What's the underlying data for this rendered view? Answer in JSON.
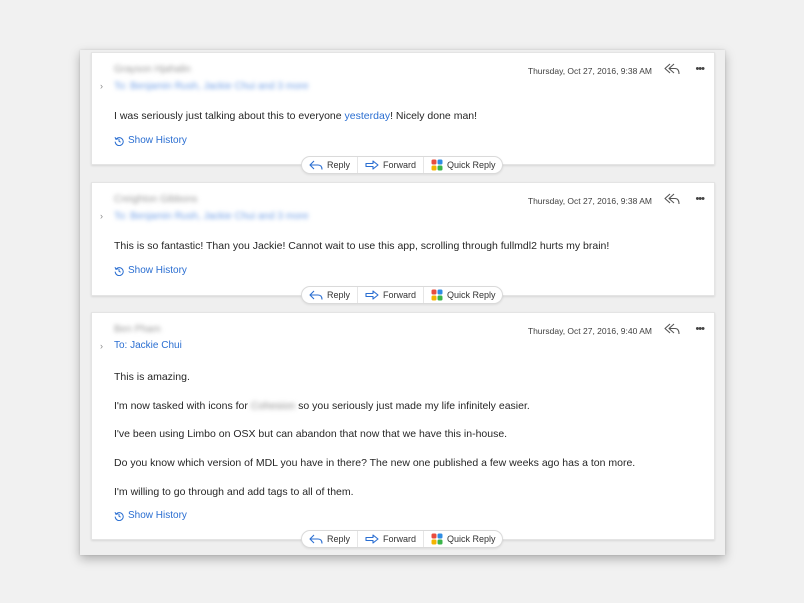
{
  "messages": [
    {
      "sender": "Grayson Hjahalin",
      "recipients": "To: Benjamin Rush, Jackie Chui and 3 more",
      "timestamp": "Thursday, Oct 27, 2016, 9:38 AM",
      "body": {
        "before": "I was seriously just talking about this to everyone ",
        "link": "yesterday",
        "after": "! Nicely done man!"
      },
      "show_history": "Show History"
    },
    {
      "sender": "Creighton Gibbons",
      "recipients": "To: Benjamin Rush, Jackie Chui and 3 more",
      "timestamp": "Thursday, Oct 27, 2016, 9:38 AM",
      "body": "This is so fantastic! Than you Jackie! Cannot wait to use this app, scrolling through fullmdl2 hurts my brain!",
      "show_history": "Show History"
    },
    {
      "sender": "Ben Pham",
      "recipients": "To: Jackie Chui",
      "timestamp": "Thursday, Oct 27, 2016, 9:40 AM",
      "paragraphs": {
        "p1": "This is amazing.",
        "p2_before": "I'm now tasked with icons for ",
        "p2_blur": "Cohesion",
        "p2_after": " so you seriously just made my life infinitely easier.",
        "p3": "I've been using Limbo on OSX but can abandon that now that we have this in-house.",
        "p4": "Do you know which version of MDL you have in there? The new one published a few weeks ago has a ton more.",
        "p5": "I'm willing to go through and add tags to all of them."
      },
      "show_history": "Show History"
    }
  ],
  "actions": {
    "reply": "Reply",
    "forward": "Forward",
    "quick_reply": "Quick Reply"
  },
  "icons": {
    "chevron": "chevron-right-icon",
    "header_reply": "reply-all-icon",
    "more": "more-icon",
    "history": "history-icon",
    "reply": "reply-icon",
    "forward": "forward-icon",
    "quick_reply": "quick-reply-icon"
  },
  "colors": {
    "accent": "#2a6ed1",
    "quick_reply_dots": [
      "#e94c3d",
      "#2f8de4",
      "#f4b400",
      "#3bb54a"
    ]
  }
}
